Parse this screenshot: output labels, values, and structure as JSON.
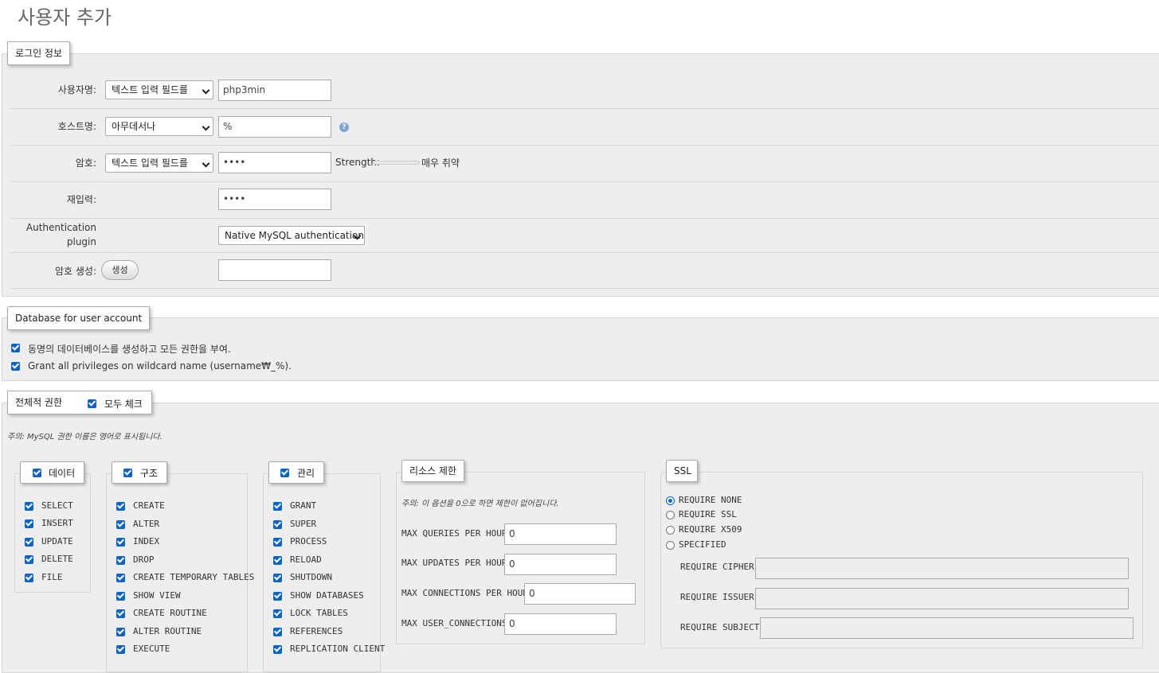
{
  "page_title": "사용자 추가",
  "login": {
    "legend": "로그인 정보",
    "username": {
      "label": "사용자명:",
      "select": "텍스트 입력 필드를",
      "value": "php3min"
    },
    "host": {
      "label": "호스트명:",
      "select": "아무데서나",
      "value": "%",
      "help_icon": "help-icon"
    },
    "password": {
      "label": "암호:",
      "select": "텍스트 입력 필드를",
      "value": "••••",
      "strength_label": "Strength:",
      "strength_text": "매우 취약",
      "strength_fraction": 0
    },
    "retype": {
      "label": "재입력:",
      "value": "••••"
    },
    "auth": {
      "label_line1": "Authentication",
      "label_line2": "plugin",
      "select": "Native MySQL authentication"
    },
    "generate": {
      "label": "암호 생성:",
      "button": "생성",
      "value": ""
    }
  },
  "database": {
    "legend": "Database for user account",
    "options": [
      {
        "label": "동명의 데이터베이스를 생성하고 모든 권한을 부여.",
        "checked": true
      },
      {
        "label": "Grant all privileges on wildcard name (username₩_%).",
        "checked": true
      }
    ]
  },
  "global": {
    "legend": "전체적 권한",
    "check_all": "모두 체크",
    "note": "주의: MySQL 권한 이름은 영어로 표시됩니다.",
    "data": {
      "legend": "데이터",
      "items": [
        "SELECT",
        "INSERT",
        "UPDATE",
        "DELETE",
        "FILE"
      ]
    },
    "structure": {
      "legend": "구조",
      "items": [
        "CREATE",
        "ALTER",
        "INDEX",
        "DROP",
        "CREATE TEMPORARY TABLES",
        "SHOW VIEW",
        "CREATE ROUTINE",
        "ALTER ROUTINE",
        "EXECUTE"
      ]
    },
    "admin": {
      "legend": "관리",
      "items": [
        "GRANT",
        "SUPER",
        "PROCESS",
        "RELOAD",
        "SHUTDOWN",
        "SHOW DATABASES",
        "LOCK TABLES",
        "REFERENCES",
        "REPLICATION CLIENT"
      ]
    },
    "resources": {
      "legend": "리소스 제한",
      "note": "주의: 이 옵션을 0으로 하면 제한이 없어집니다.",
      "limits": [
        {
          "label": "MAX QUERIES PER HOUR",
          "value": "0"
        },
        {
          "label": "MAX UPDATES PER HOUR",
          "value": "0"
        },
        {
          "label": "MAX CONNECTIONS PER HOUR",
          "value": "0"
        },
        {
          "label": "MAX USER_CONNECTIONS",
          "value": "0"
        }
      ]
    },
    "ssl": {
      "legend": "SSL",
      "options": [
        {
          "label": "REQUIRE NONE",
          "selected": true
        },
        {
          "label": "REQUIRE SSL",
          "selected": false
        },
        {
          "label": "REQUIRE X509",
          "selected": false
        },
        {
          "label": "SPECIFIED",
          "selected": false
        }
      ],
      "fields": [
        {
          "label": "REQUIRE CIPHER",
          "value": ""
        },
        {
          "label": "REQUIRE ISSUER",
          "value": ""
        },
        {
          "label": "REQUIRE SUBJECT",
          "value": ""
        }
      ]
    }
  },
  "colors": {
    "accent": "#0a63c6",
    "panel": "#eeeeee",
    "border": "#d6d6d6"
  }
}
